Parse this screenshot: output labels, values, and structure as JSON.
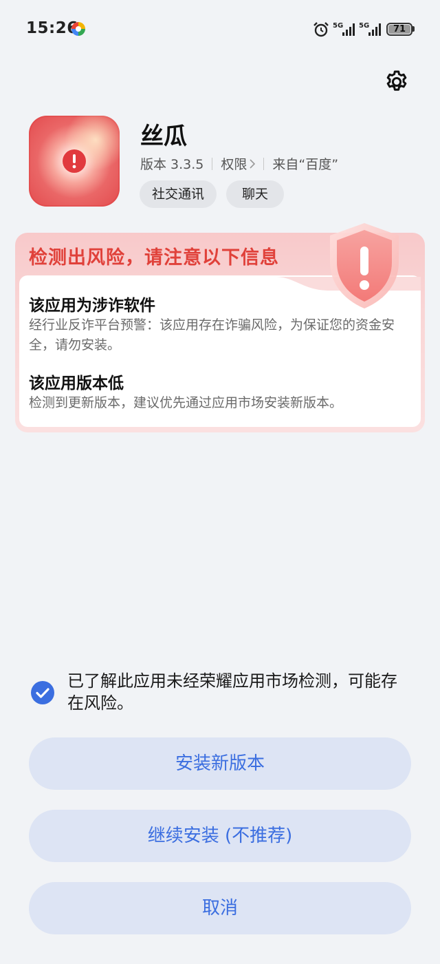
{
  "status_bar": {
    "time": "15:26",
    "battery": "71",
    "network_1": "5G",
    "network_2": "5G",
    "icons": [
      "pin-app-icon",
      "alarm-icon",
      "signal-icon",
      "signal-icon",
      "battery-icon"
    ]
  },
  "header": {
    "settings_icon": "gear-icon"
  },
  "app": {
    "name": "丝瓜",
    "version": "版本 3.3.5",
    "permissions": "权限",
    "source": "来自“百度”",
    "tags": [
      "社交通讯",
      "聊天"
    ]
  },
  "warning": {
    "title": "检测出风险，请注意以下信息",
    "items": [
      {
        "title": "该应用为涉诈软件",
        "desc": "经行业反诈平台预警：该应用存在诈骗风险，为保证您的资金安全，请勿安装。"
      },
      {
        "title": "该应用版本低",
        "desc": "检测到更新版本，建议优先通过应用市场安装新版本。"
      }
    ]
  },
  "acknowledge": {
    "checked": true,
    "text": "已了解此应用未经荣耀应用市场检测，可能存在风险。"
  },
  "buttons": {
    "install_new": "安装新版本",
    "continue_install": "继续安装 (不推荐)",
    "cancel": "取消"
  },
  "colors": {
    "background": "#f1f3f6",
    "warning_red": "#e0413a",
    "accent_blue": "#3b6ee0",
    "button_bg": "#dde4f4"
  }
}
